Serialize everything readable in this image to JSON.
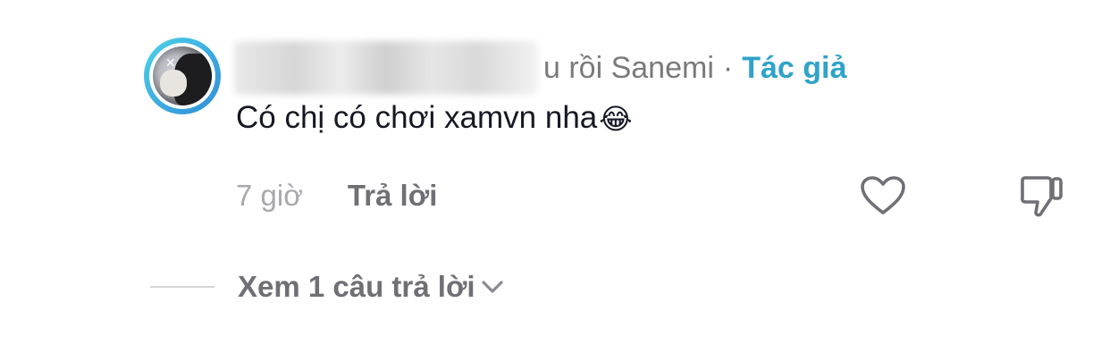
{
  "comment": {
    "username_visible_suffix": "u rồi Sanemi",
    "separator": "·",
    "author_tag": "Tác giả",
    "text": "Có chị có chơi xamvn nha",
    "emoji": "😂",
    "time": "7 giờ",
    "reply_label": "Trả lời",
    "icons": {
      "like": "heart-outline-icon",
      "dislike": "thumbs-down-outline-icon",
      "expand": "chevron-down-icon"
    }
  },
  "replies": {
    "view_label": "Xem 1 câu trả lời"
  },
  "colors": {
    "author_tag": "#2fa3c9",
    "avatar_ring": "#3aa6e0",
    "primary_text": "#161823",
    "secondary_text": "#6f6f75",
    "muted_text": "#a8a8ad"
  }
}
